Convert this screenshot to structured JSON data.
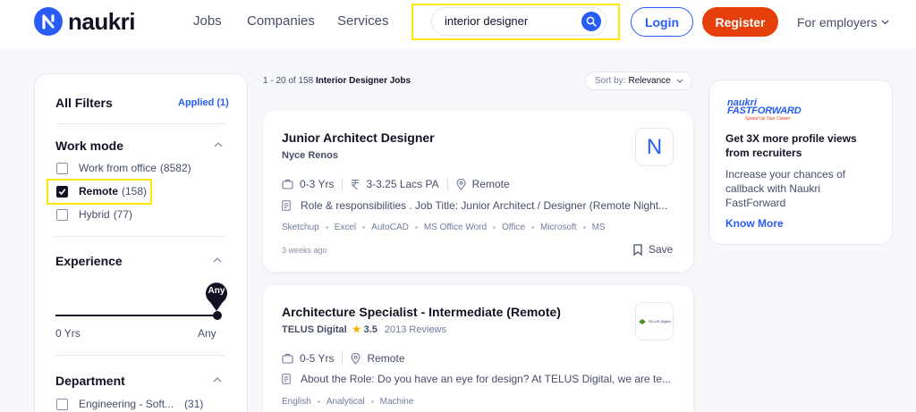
{
  "header": {
    "logo_text": "naukri",
    "nav": [
      "Jobs",
      "Companies",
      "Services"
    ],
    "search_value": "interior designer",
    "login_label": "Login",
    "register_label": "Register",
    "employers_label": "For employers"
  },
  "filters": {
    "title": "All Filters",
    "applied": "Applied (1)",
    "work_mode": {
      "heading": "Work mode",
      "options": [
        {
          "label": "Work from office",
          "count": "(8582)",
          "checked": false
        },
        {
          "label": "Remote",
          "count": "(158)",
          "checked": true
        },
        {
          "label": "Hybrid",
          "count": "(77)",
          "checked": false
        }
      ]
    },
    "experience": {
      "heading": "Experience",
      "tip": "Any",
      "min_label": "0 Yrs",
      "max_label": "Any"
    },
    "department": {
      "heading": "Department",
      "options": [
        {
          "label": "Engineering - Soft...",
          "count": "(31)",
          "checked": false
        }
      ]
    }
  },
  "results": {
    "range": "1 - 20 of 158",
    "query": "Interior Designer Jobs",
    "sort_label": "Sort by:",
    "sort_value": "Relevance"
  },
  "jobs": [
    {
      "title": "Junior Architect Designer",
      "company": "Nyce Renos",
      "logo_letter": "N",
      "experience": "0-3 Yrs",
      "salary": "3-3.25 Lacs PA",
      "location": "Remote",
      "description": "Role & responsibilities . Job Title: Junior Architect / Designer (Remote Night...",
      "tags": [
        "Sketchup",
        "Excel",
        "AutoCAD",
        "MS Office Word",
        "Office",
        "Microsoft",
        "MS"
      ],
      "posted": "3 weeks ago",
      "save_label": "Save"
    },
    {
      "title": "Architecture Specialist - Intermediate (Remote)",
      "company": "TELUS Digital",
      "rating": "3.5",
      "reviews": "2013 Reviews",
      "logo_text": "TELUS Digital",
      "experience": "0-5 Yrs",
      "location": "Remote",
      "description": "About the Role: Do you have an eye for design? At TELUS Digital, we are te...",
      "tags": [
        "English",
        "Analytical",
        "Machine"
      ]
    }
  ],
  "promo": {
    "logo_top": "naukri",
    "logo_bottom": "FASTFORWARD",
    "tagline": "Speed Up Your Career",
    "heading": "Get 3X more profile views from recruiters",
    "body": "Increase your chances of callback with Naukri FastForward",
    "link": "Know More"
  },
  "colors": {
    "brand_blue": "#275df5",
    "register_orange": "#e5400c",
    "highlight_yellow": "#ffe600"
  }
}
